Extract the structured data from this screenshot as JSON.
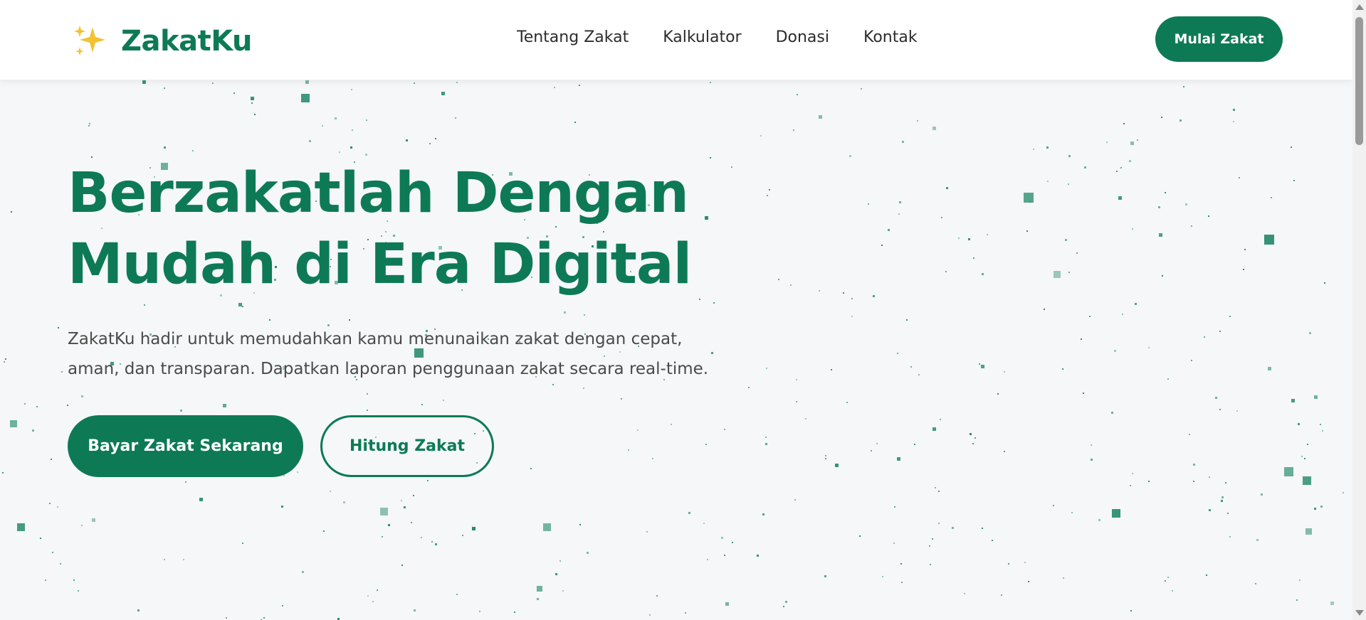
{
  "navbar": {
    "brand": {
      "icon": "sparkles-icon",
      "name": "ZakatKu"
    },
    "links": [
      {
        "label": "Tentang Zakat"
      },
      {
        "label": "Kalkulator"
      },
      {
        "label": "Donasi"
      },
      {
        "label": "Kontak"
      }
    ],
    "cta_label": "Mulai Zakat"
  },
  "hero": {
    "title_line1": "Berzakatlah Dengan",
    "title_line2": "Mudah di Era Digital",
    "description_line1": "ZakatKu hadir untuk memudahkan kamu menunaikan zakat dengan cepat,",
    "description_line2": "aman, dan transparan. Dapatkan laporan penggunaan zakat secara real-time.",
    "primary_button": "Bayar Zakat Sekarang",
    "secondary_button": "Hitung Zakat"
  },
  "theme": {
    "accent": "#0d7a55",
    "brand_icon_color": "#f2c230",
    "background": "#f5f7f8",
    "particle_color": "#0f7f5a"
  }
}
